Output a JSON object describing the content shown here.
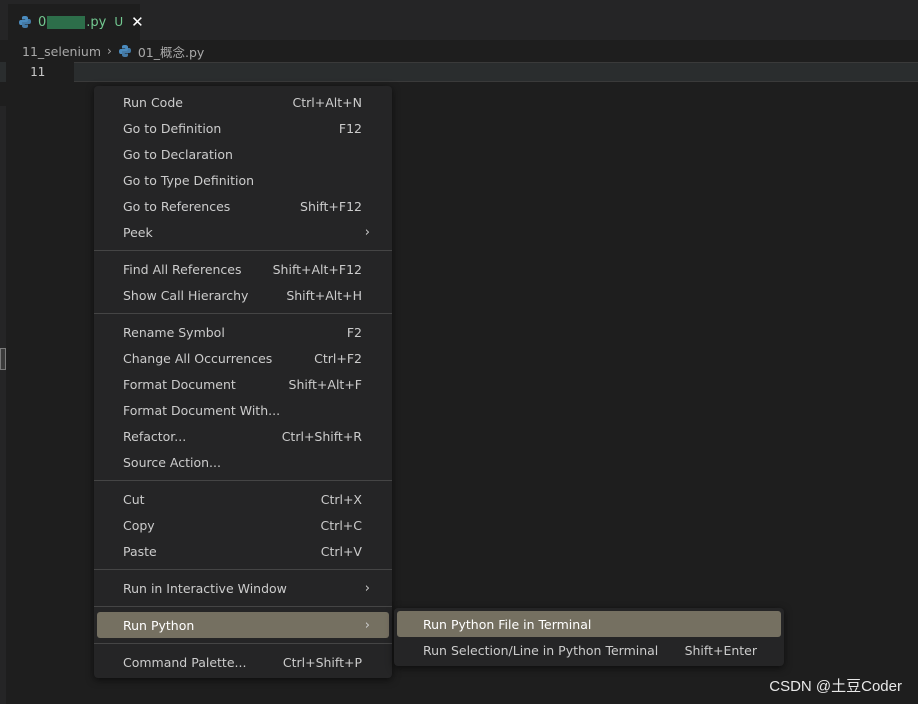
{
  "tab": {
    "name_prefix": "0",
    "name_suffix": ".py",
    "badge": "U",
    "close": "✕",
    "icon": "python-file-icon"
  },
  "breadcrumb": {
    "folder": "11_selenium",
    "separator": "›",
    "file": "01_概念.py"
  },
  "editor": {
    "line_number": "11"
  },
  "context_menu": {
    "groups": [
      [
        {
          "label": "Run Code",
          "key": "Ctrl+Alt+N"
        },
        {
          "label": "Go to Definition",
          "key": "F12"
        },
        {
          "label": "Go to Declaration",
          "key": ""
        },
        {
          "label": "Go to Type Definition",
          "key": ""
        },
        {
          "label": "Go to References",
          "key": "Shift+F12"
        },
        {
          "label": "Peek",
          "key": "",
          "submenu": true
        }
      ],
      [
        {
          "label": "Find All References",
          "key": "Shift+Alt+F12"
        },
        {
          "label": "Show Call Hierarchy",
          "key": "Shift+Alt+H"
        }
      ],
      [
        {
          "label": "Rename Symbol",
          "key": "F2"
        },
        {
          "label": "Change All Occurrences",
          "key": "Ctrl+F2"
        },
        {
          "label": "Format Document",
          "key": "Shift+Alt+F"
        },
        {
          "label": "Format Document With...",
          "key": ""
        },
        {
          "label": "Refactor...",
          "key": "Ctrl+Shift+R"
        },
        {
          "label": "Source Action...",
          "key": ""
        }
      ],
      [
        {
          "label": "Cut",
          "key": "Ctrl+X"
        },
        {
          "label": "Copy",
          "key": "Ctrl+C"
        },
        {
          "label": "Paste",
          "key": "Ctrl+V"
        }
      ],
      [
        {
          "label": "Run in Interactive Window",
          "key": "",
          "submenu": true
        }
      ],
      [
        {
          "label": "Run Python",
          "key": "",
          "submenu": true,
          "active": true
        }
      ],
      [
        {
          "label": "Command Palette...",
          "key": "Ctrl+Shift+P"
        }
      ]
    ],
    "submenu_arrow": "›"
  },
  "run_python_submenu": [
    {
      "label": "Run Python File in Terminal",
      "key": "",
      "active": true
    },
    {
      "label": "Run Selection/Line in Python Terminal",
      "key": "Shift+Enter"
    }
  ],
  "watermark": "CSDN @土豆Coder",
  "colors": {
    "background": "#1e1e1e",
    "menu_bg": "#252526",
    "active_item": "#757061",
    "untracked_green": "#73c991",
    "python_blue": "#4b8bbe"
  }
}
